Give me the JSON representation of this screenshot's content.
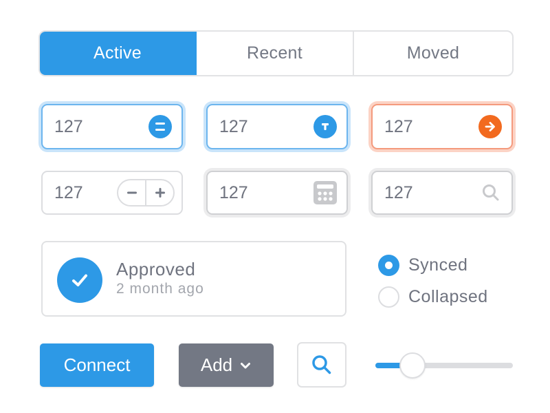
{
  "tabs": [
    {
      "label": "Active",
      "selected": true
    },
    {
      "label": "Recent",
      "selected": false
    },
    {
      "label": "Moved",
      "selected": false
    }
  ],
  "fields": [
    {
      "value": "127",
      "icon": "divide-icon",
      "state": "focused",
      "accent": "#2d99e6"
    },
    {
      "value": "127",
      "icon": "text-t-icon",
      "state": "focused",
      "accent": "#2d99e6"
    },
    {
      "value": "127",
      "icon": "arrow-right-icon",
      "state": "error",
      "accent": "#f26a1f"
    },
    {
      "value": "127",
      "icon": "stepper",
      "state": "default"
    },
    {
      "value": "127",
      "icon": "calculator-icon",
      "state": "disabled"
    },
    {
      "value": "127",
      "icon": "search-icon",
      "state": "disabled"
    }
  ],
  "stepper": {
    "minus": "−",
    "plus": "+"
  },
  "card": {
    "title": "Approved",
    "subtitle": "2 month ago",
    "icon": "check-icon"
  },
  "radios": [
    {
      "label": "Synced",
      "checked": true
    },
    {
      "label": "Collapsed",
      "checked": false
    }
  ],
  "buttons": {
    "connect": "Connect",
    "add": "Add",
    "search_icon": "search-icon"
  },
  "slider": {
    "value": 0.27
  },
  "colors": {
    "primary": "#2d99e6",
    "warning": "#f26a1f",
    "neutral": "#737884",
    "border": "#dcdde0"
  }
}
